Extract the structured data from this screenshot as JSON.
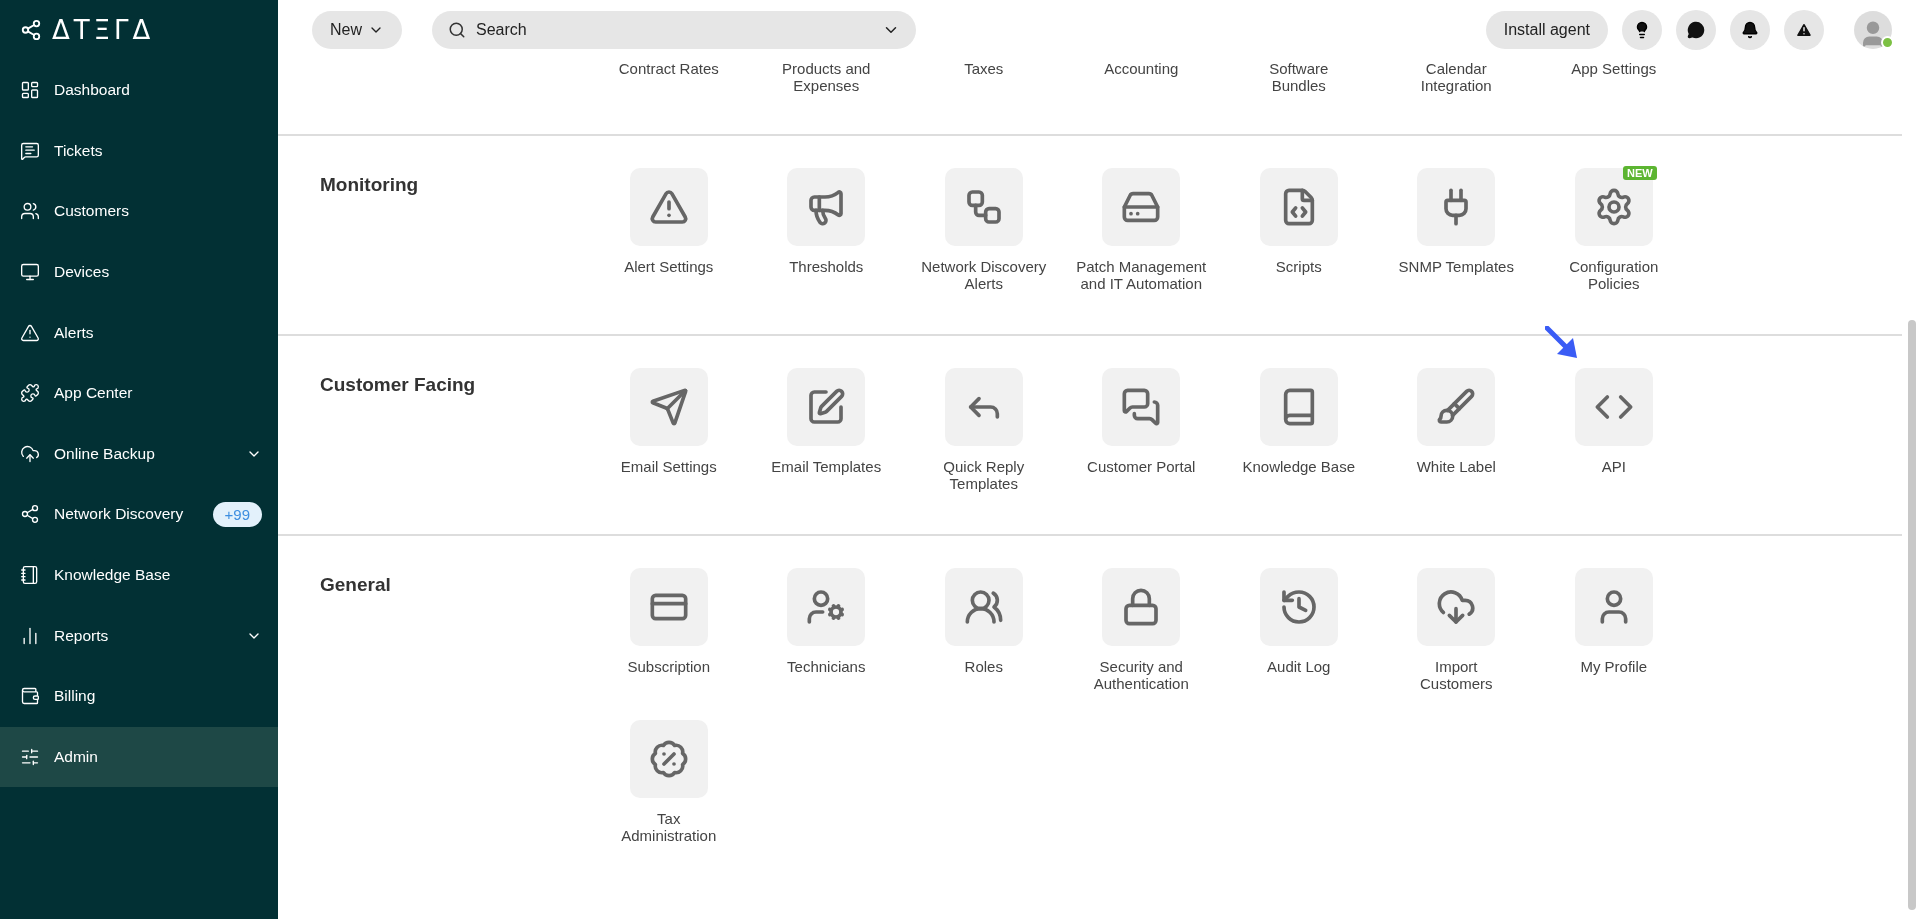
{
  "sidebar": {
    "logo": "ΔTΞΓΔ",
    "items": [
      {
        "label": "Dashboard",
        "selected": false
      },
      {
        "label": "Tickets",
        "selected": false
      },
      {
        "label": "Customers",
        "selected": false
      },
      {
        "label": "Devices",
        "selected": false
      },
      {
        "label": "Alerts",
        "selected": false
      },
      {
        "label": "App Center",
        "selected": false
      },
      {
        "label": "Online Backup",
        "selected": false,
        "has_submenu": true
      },
      {
        "label": "Network Discovery",
        "selected": false,
        "badge": "+99"
      },
      {
        "label": "Knowledge Base",
        "selected": false
      },
      {
        "label": "Reports",
        "selected": false,
        "has_submenu": true
      },
      {
        "label": "Billing",
        "selected": false
      },
      {
        "label": "Admin",
        "selected": true
      }
    ]
  },
  "topbar": {
    "new_button": "New",
    "search": {
      "placeholder": "Search"
    },
    "install_button": "Install agent",
    "user_online": true
  },
  "partial_row": {
    "items": [
      "Contract Rates",
      "Products and\nExpenses",
      "Taxes",
      "Accounting",
      "Software\nBundles",
      "Calendar\nIntegration",
      "App Settings"
    ]
  },
  "sections": [
    {
      "title": "Monitoring",
      "items": [
        {
          "label": "Alert Settings"
        },
        {
          "label": "Thresholds"
        },
        {
          "label": "Network Discovery\nAlerts"
        },
        {
          "label": "Patch Management\nand IT Automation"
        },
        {
          "label": "Scripts"
        },
        {
          "label": "SNMP Templates"
        },
        {
          "label": "Configuration\nPolicies",
          "badge": "NEW"
        }
      ]
    },
    {
      "title": "Customer Facing",
      "items": [
        {
          "label": "Email Settings"
        },
        {
          "label": "Email Templates"
        },
        {
          "label": "Quick Reply\nTemplates"
        },
        {
          "label": "Customer Portal"
        },
        {
          "label": "Knowledge Base"
        },
        {
          "label": "White Label"
        },
        {
          "label": "API",
          "pointed_at": true
        }
      ]
    },
    {
      "title": "General",
      "items": [
        {
          "label": "Subscription"
        },
        {
          "label": "Technicians"
        },
        {
          "label": "Roles"
        },
        {
          "label": "Security and\nAuthentication"
        },
        {
          "label": "Audit Log"
        },
        {
          "label": "Import\nCustomers"
        },
        {
          "label": "My Profile"
        },
        {
          "label": "Tax\nAdministration"
        }
      ]
    }
  ]
}
